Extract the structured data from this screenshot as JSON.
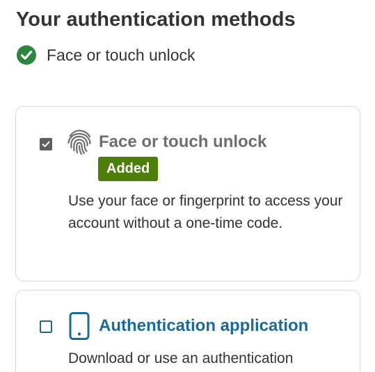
{
  "page": {
    "title": "Your authentication methods"
  },
  "summary": {
    "icon": "check-circle-icon",
    "label": "Face or touch unlock",
    "color": "#2e8540"
  },
  "methods": [
    {
      "title": "Face or touch unlock",
      "checked": true,
      "icon": "fingerprint-icon",
      "badge": "Added",
      "badge_color": "#4c7f0a",
      "description": "Use your face or fingerprint to access your account without a one-time code."
    },
    {
      "title": "Authentication application",
      "checked": false,
      "icon": "phone-icon",
      "title_color": "#1b6a9a",
      "description": "Download or use an authentication"
    }
  ]
}
